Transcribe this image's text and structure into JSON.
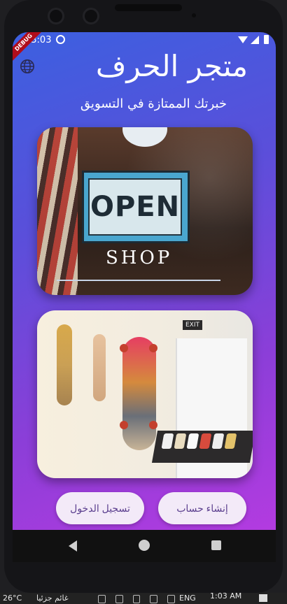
{
  "status_bar": {
    "time": "13:03"
  },
  "debug_label": "DEBUG",
  "app": {
    "title": "متجر الحرف",
    "subtitle": "خبرتك الممتازة في التسويق"
  },
  "card1": {
    "sign_text": "OPEN",
    "shop_text": "SHOP"
  },
  "card2": {
    "exit_text": "EXIT"
  },
  "buttons": {
    "login": "تسجيل الدخول",
    "signup": "إنشاء حساب"
  },
  "taskbar": {
    "temperature": "26°C",
    "weather": "غائم جزئيا",
    "language": "ENG",
    "clock": "1:03 AM"
  },
  "colors": {
    "gradient_start": "#3c60e0",
    "gradient_end": "#b33be0",
    "button_bg": "#f3eaf8",
    "button_text": "#5b3f8e",
    "debug_banner": "#b00d1b"
  }
}
